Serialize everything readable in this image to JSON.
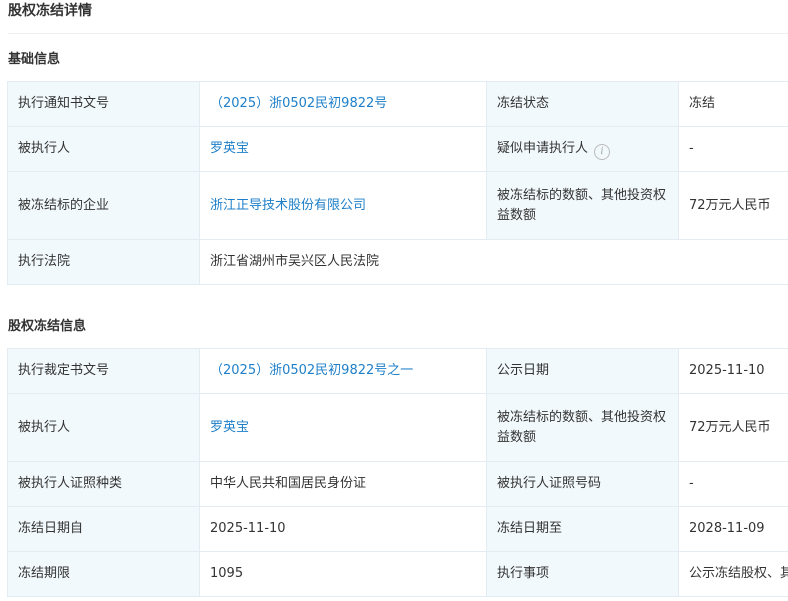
{
  "page": {
    "title": "股权冻结详情"
  },
  "basic": {
    "title": "基础信息",
    "rows": [
      {
        "label1": "执行通知书文号",
        "value1": "（2025）浙0502民初9822号",
        "label2": "冻结状态",
        "value2": "冻结"
      },
      {
        "label1": "被执行人",
        "value1": "罗英宝",
        "label2": "疑似申请执行人",
        "value2": "-"
      },
      {
        "label1": "被冻结标的企业",
        "value1": "浙江正导技术股份有限公司",
        "label2": "被冻结标的数额、其他投资权益数额",
        "value2": "72万元人民币"
      },
      {
        "label1": "执行法院",
        "value1": "浙江省湖州市吴兴区人民法院"
      }
    ]
  },
  "freeze": {
    "title": "股权冻结信息",
    "rows": [
      {
        "label1": "执行裁定书文号",
        "value1": "（2025）浙0502民初9822号之一",
        "label2": "公示日期",
        "value2": "2025-11-10"
      },
      {
        "label1": "被执行人",
        "value1": "罗英宝",
        "label2": "被冻结标的数额、其他投资权益数额",
        "value2": "72万元人民币"
      },
      {
        "label1": "被执行人证照种类",
        "value1": "中华人民共和国居民身份证",
        "label2": "被执行人证照号码",
        "value2": "-"
      },
      {
        "label1": "冻结日期自",
        "value1": "2025-11-10",
        "label2": "冻结日期至",
        "value2": "2028-11-09"
      },
      {
        "label1": "冻结期限",
        "value1": "1095",
        "label2": "执行事项",
        "value2": "公示冻结股权、其他投资权益"
      }
    ]
  }
}
